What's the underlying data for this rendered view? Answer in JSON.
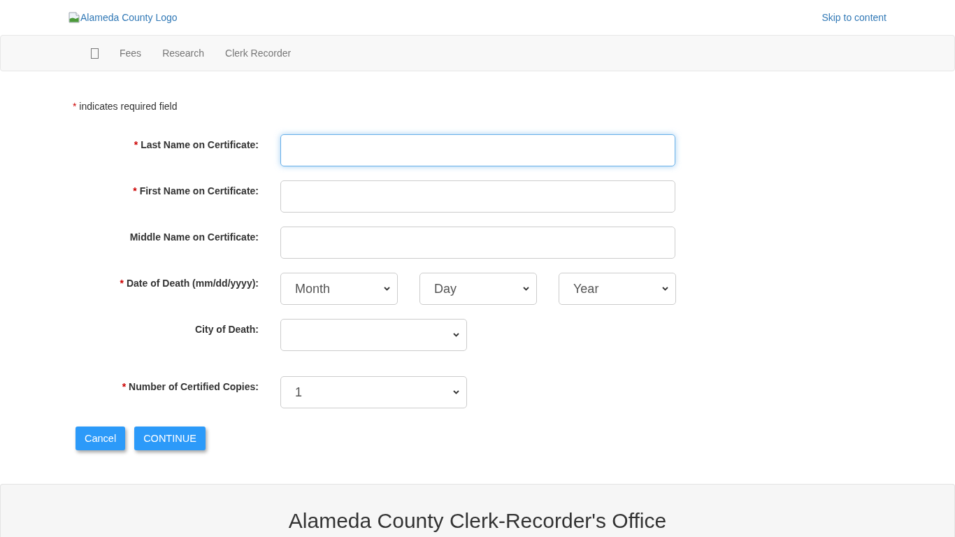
{
  "header": {
    "logo_alt": "Alameda County Logo",
    "skip_link": "Skip to content"
  },
  "navbar": {
    "links": [
      "Fees",
      "Research",
      "Clerk Recorder"
    ]
  },
  "required_note": {
    "marker": "*",
    "text": "indicates required field"
  },
  "form": {
    "fields": [
      {
        "kind": "text",
        "required_mark": "*",
        "label": "Last Name on Certificate:",
        "focused": true
      },
      {
        "kind": "text",
        "required_mark": "*",
        "label": "First Name on Certificate:",
        "focused": false
      },
      {
        "kind": "text",
        "label": "Middle Name on Certificate:",
        "focused": false
      },
      {
        "kind": "date",
        "required_mark": "*",
        "label": "Date of Death (mm/dd/yyyy):",
        "selects": [
          "Month",
          "Day",
          "Year"
        ]
      },
      {
        "kind": "select",
        "label": "City of Death:"
      },
      {
        "kind": "select",
        "required_mark": "*",
        "label": "Number of Certified Copies:",
        "value": "1"
      }
    ]
  },
  "buttons": [
    "Cancel",
    "CONTINUE"
  ],
  "footer": {
    "title": "Alameda County Clerk-Recorder's Office"
  }
}
